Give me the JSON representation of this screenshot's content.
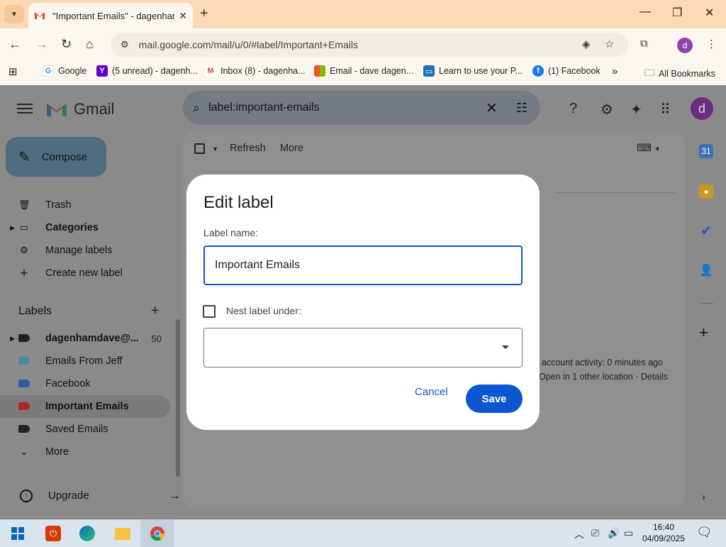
{
  "browser": {
    "tab_title": "\"Important Emails\" - dagenham",
    "url": "mail.google.com/mail/u/0/#label/Important+Emails",
    "profile_initial": "d",
    "bookmarks": [
      {
        "label": "Google",
        "icon": "google-icon",
        "color": "#4285f4"
      },
      {
        "label": "(5 unread) - dagenh...",
        "icon": "yahoo-icon",
        "color": "#6001d2"
      },
      {
        "label": "Inbox (8) - dagenha...",
        "icon": "gmail-icon",
        "color": "#ea4335"
      },
      {
        "label": "Email - dave dagen...",
        "icon": "microsoft-icon",
        "color": "#f25022"
      },
      {
        "label": "Learn to use your P...",
        "icon": "monitor-icon",
        "color": "#1e6fb8"
      },
      {
        "label": "(1) Facebook",
        "icon": "facebook-icon",
        "color": "#1877f2"
      }
    ],
    "all_bookmarks": "All Bookmarks",
    "more_bookmarks": "»"
  },
  "gmail": {
    "logo_text": "Gmail",
    "search_query": "label:important-emails",
    "avatar_initial": "d",
    "compose_label": "Compose",
    "sidebar": {
      "items": [
        {
          "label": "Trash",
          "icon": "trash-icon"
        },
        {
          "label": "Categories",
          "icon": "label-outline-icon"
        },
        {
          "label": "Manage labels",
          "icon": "gear-icon"
        },
        {
          "label": "Create new label",
          "icon": "plus-icon"
        }
      ],
      "labels_header": "Labels",
      "labels": [
        {
          "label": "dagenhamdave@...",
          "count": "50",
          "color": "#222222"
        },
        {
          "label": "Emails From Jeff",
          "count": "",
          "color": "#4a87a8"
        },
        {
          "label": "Facebook",
          "count": "",
          "color": "#2a5ca8"
        },
        {
          "label": "Important Emails",
          "count": "",
          "color": "#b3261e"
        },
        {
          "label": "Saved Emails",
          "count": "",
          "color": "#222222"
        }
      ],
      "more_label": "More",
      "upgrade_label": "Upgrade"
    },
    "toolbar": {
      "refresh": "Refresh",
      "more": "More"
    },
    "account_activity": "account activity: 0 minutes ago",
    "open_locations": "Open in 1 other location · Details"
  },
  "dialog": {
    "title": "Edit label",
    "label_name_caption": "Label name:",
    "label_name_value": "Important Emails",
    "nest_caption": "Nest label under:",
    "nest_checked": false,
    "nest_value": "",
    "cancel": "Cancel",
    "save": "Save",
    "accent": "#0b57d0"
  },
  "taskbar": {
    "time": "16:40",
    "date": "04/09/2025"
  }
}
